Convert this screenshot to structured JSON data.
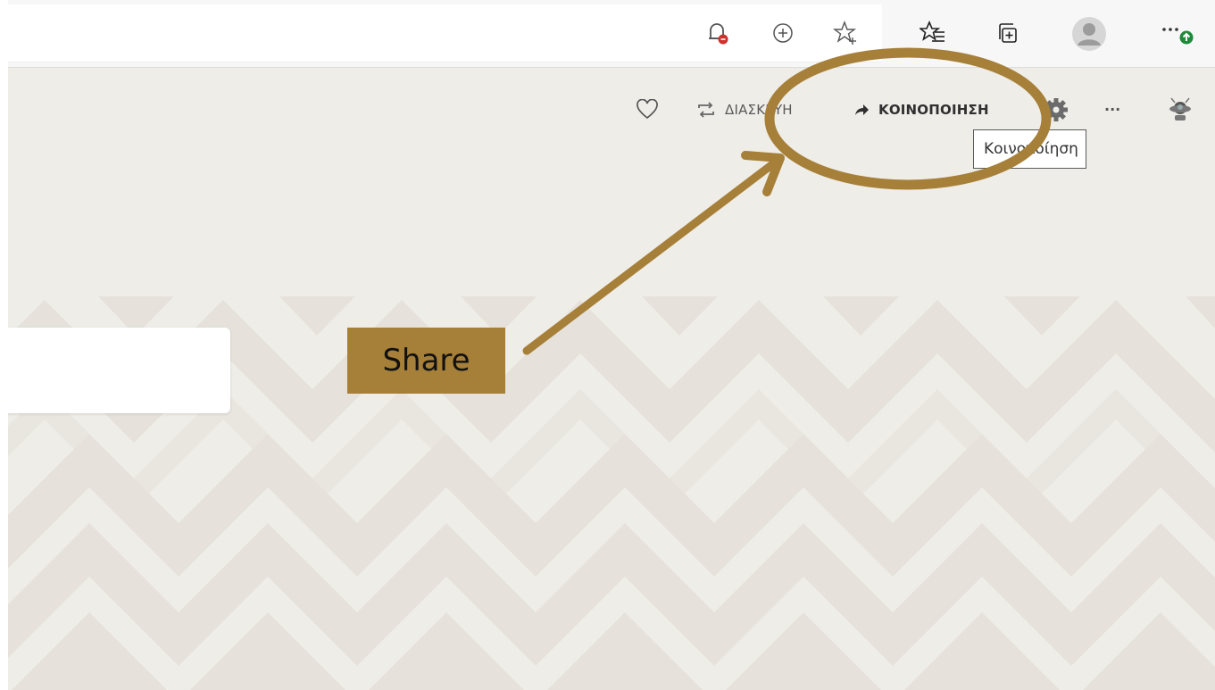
{
  "browser": {
    "icons": [
      "tracking-prevention-icon",
      "add-favorite-plus-icon",
      "add-to-favorites-icon",
      "favorites-list-icon",
      "collections-icon",
      "profile-icon",
      "settings-and-more-icon"
    ],
    "more_dots": "···",
    "update_badge_color": "#1e8a3a",
    "alert_badge_color": "#d0312d"
  },
  "toolbar": {
    "remix_label": "ΔΙΑΣΚΕΥΗ",
    "share_label": "ΚΟΙΝΟΠΟΙΗΣΗ",
    "more_label": "···",
    "tooltip": "Κοινοποίηση"
  },
  "annotation": {
    "callout_text": "Share",
    "color": "#a67f38"
  },
  "colors": {
    "page_background": "#efede8",
    "zigzag_dark": "#e6e2db"
  }
}
